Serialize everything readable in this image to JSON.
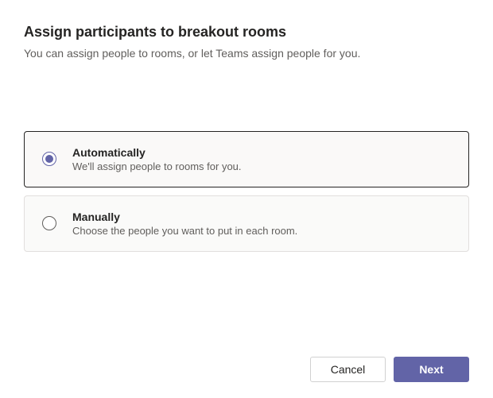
{
  "header": {
    "title": "Assign participants to breakout rooms",
    "subtitle": "You can assign people to rooms, or let Teams assign people for you."
  },
  "options": [
    {
      "id": "auto",
      "title": "Automatically",
      "description": "We'll assign people to rooms for you.",
      "selected": true
    },
    {
      "id": "manual",
      "title": "Manually",
      "description": "Choose the people you want to put in each room.",
      "selected": false
    }
  ],
  "footer": {
    "cancel_label": "Cancel",
    "next_label": "Next"
  }
}
